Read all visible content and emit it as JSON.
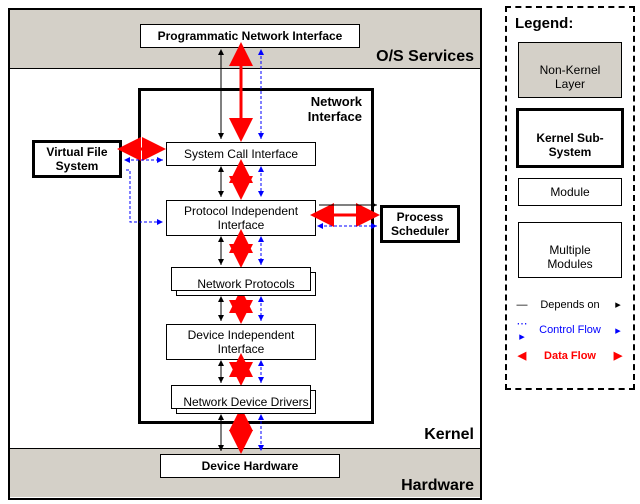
{
  "layers": {
    "os_services": "O/S Services",
    "kernel": "Kernel",
    "hardware": "Hardware"
  },
  "boxes": {
    "pni": "Programmatic Network Interface",
    "ni": "Network\nInterface",
    "vfs": "Virtual File\nSystem",
    "sci": "System Call Interface",
    "pii": "Protocol Independent\nInterface",
    "ps": "Process\nScheduler",
    "np": "Network Protocols",
    "dii": "Device Independent\nInterface",
    "ndd": "Network Device Drivers",
    "dh": "Device Hardware"
  },
  "legend": {
    "title": "Legend:",
    "non_kernel": "Non-Kernel\nLayer",
    "kernel_sub": "Kernel Sub-\nSystem",
    "module": "Module",
    "mult_modules": "Multiple\nModules",
    "depends_on": "Depends on",
    "control_flow": "Control Flow",
    "data_flow": "Data Flow"
  },
  "colors": {
    "data_flow": "#ff0000",
    "control_flow": "#0000ff",
    "depends_on": "#000000",
    "layer_bg": "#d4d0c8"
  }
}
